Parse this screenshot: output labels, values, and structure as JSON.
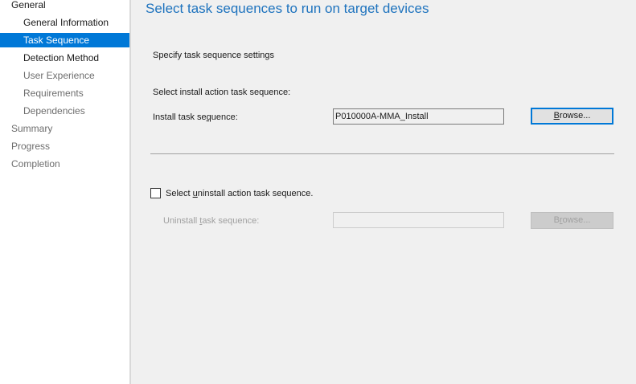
{
  "sidebar": {
    "items": [
      {
        "label": "General",
        "level": "top",
        "state": "active"
      },
      {
        "label": "General Information",
        "level": "sub",
        "state": "active"
      },
      {
        "label": "Task Sequence",
        "level": "sub",
        "state": "selected"
      },
      {
        "label": "Detection Method",
        "level": "sub",
        "state": "active"
      },
      {
        "label": "User Experience",
        "level": "sub",
        "state": "inactive"
      },
      {
        "label": "Requirements",
        "level": "sub",
        "state": "inactive"
      },
      {
        "label": "Dependencies",
        "level": "sub",
        "state": "inactive"
      },
      {
        "label": "Summary",
        "level": "top",
        "state": "inactive"
      },
      {
        "label": "Progress",
        "level": "top",
        "state": "inactive"
      },
      {
        "label": "Completion",
        "level": "top",
        "state": "inactive"
      }
    ]
  },
  "main": {
    "title": "Select task sequences to run on target devices",
    "subtitle": "Specify task sequence settings",
    "install": {
      "section_label": "Select install action task sequence:",
      "field_label_pre": "Install task se",
      "field_label_ul": "q",
      "field_label_post": "uence:",
      "value": "P010000A-MMA_Install",
      "browse_pre": "",
      "browse_ul": "B",
      "browse_post": "rowse..."
    },
    "uninstall": {
      "checkbox_label_pre": "Select ",
      "checkbox_label_ul": "u",
      "checkbox_label_post": "ninstall action task sequence.",
      "checked": false,
      "field_label_pre": "Uninstall ",
      "field_label_ul": "t",
      "field_label_post": "ask sequence:",
      "value": "",
      "browse_pre": "B",
      "browse_ul": "r",
      "browse_post": "owse..."
    }
  },
  "colors": {
    "accent": "#0078d7",
    "title": "#1e73be",
    "window_bg": "#f0f0f0",
    "sidebar_bg": "#ffffff"
  }
}
